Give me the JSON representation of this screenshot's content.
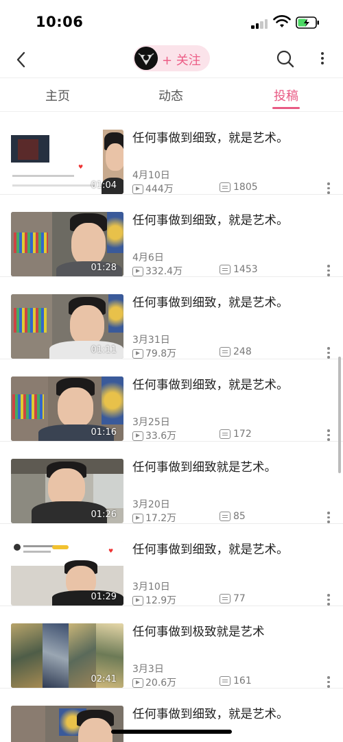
{
  "status_bar": {
    "time": "10:06"
  },
  "header": {
    "follow_label": "+ 关注"
  },
  "tabs": [
    {
      "label": "主页"
    },
    {
      "label": "动态"
    },
    {
      "label": "投稿"
    }
  ],
  "active_tab": "投稿",
  "videos": [
    {
      "title": "任何事做到细致，就是艺术。",
      "date": "4月10日",
      "plays": "444万",
      "comments": "1805",
      "duration": "01:04"
    },
    {
      "title": "任何事做到细致，就是艺术。",
      "date": "4月6日",
      "plays": "332.4万",
      "comments": "1453",
      "duration": "01:28"
    },
    {
      "title": "任何事做到细致，就是艺术。",
      "date": "3月31日",
      "plays": "79.8万",
      "comments": "248",
      "duration": "01:11"
    },
    {
      "title": "任何事做到细致，就是艺术。",
      "date": "3月25日",
      "plays": "33.6万",
      "comments": "172",
      "duration": "01:16"
    },
    {
      "title": "任何事做到细致就是艺术。",
      "date": "3月20日",
      "plays": "17.2万",
      "comments": "85",
      "duration": "01:26"
    },
    {
      "title": "任何事做到细致，就是艺术。",
      "date": "3月10日",
      "plays": "12.9万",
      "comments": "77",
      "duration": "01:29"
    },
    {
      "title": "任何事做到极致就是艺术",
      "date": "3月3日",
      "plays": "20.6万",
      "comments": "161",
      "duration": "02:41"
    },
    {
      "title": "任何事做到细致，就是艺术。",
      "date": "",
      "plays": "",
      "comments": "",
      "duration": ""
    }
  ],
  "colors": {
    "accent": "#e85a84",
    "pill_bg": "#fbe3ea"
  },
  "icons": [
    "back-icon",
    "search-icon",
    "more-icon",
    "play-count-icon",
    "comment-icon",
    "kebab-icon"
  ]
}
